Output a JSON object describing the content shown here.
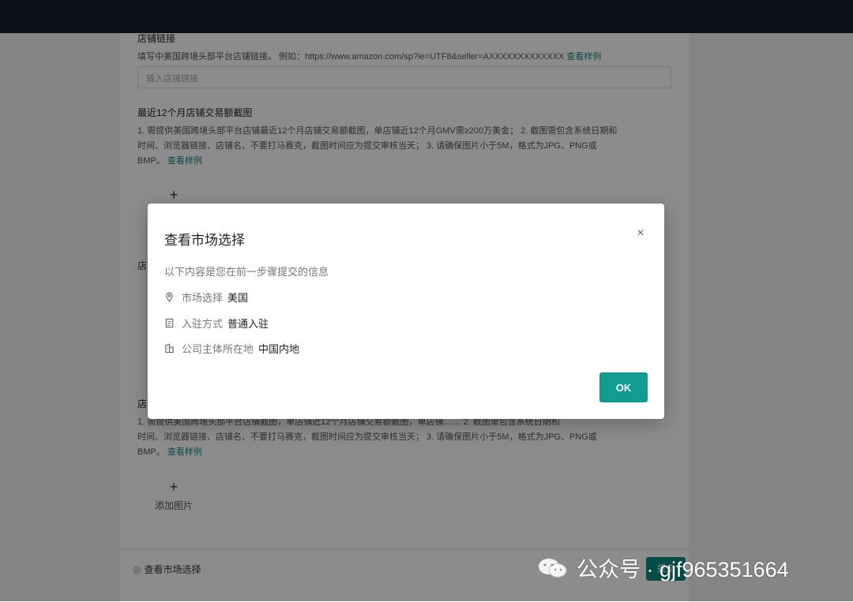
{
  "page": {
    "store_link": {
      "title": "店铺链接",
      "text_prefix": "填写中美国跨境头部平台店铺链接。 例如：https://www.amazon.com/sp?ie=UTF8&seller=AXXXXXXXXXXXXX",
      "example_link": "查看样例",
      "input_placeholder": "输入店铺链接"
    },
    "section_gmv": {
      "title": "最近12个月店铺交易额截图",
      "text_line1": "1. 需提供美国跨境头部平台店铺最近12个月店铺交易额截图，单店铺近12个月GMV需≥200万美金； 2. 截图需包含系统日期和",
      "text_line2": "时间、浏览器链接、店铺名、不要打马赛克，截图时间应为提交审核当天； 3. 请确保图片小于5M，格式为JPG、PNG或",
      "text_line3_prefix": "BMP。",
      "example_link": "查看样例"
    },
    "section_hidden_title": "店",
    "section_third": {
      "title": "店",
      "text_line1": "1. 需提供美国跨境头部平台店铺截图，单店铺近12个月店铺交易额截图，单店铺…… 2. 截图需包含系统日期和",
      "text_line2": "时间、浏览器链接、店铺名、不要打马赛克，截图时间应为提交审核当天； 3. 请确保图片小于5M，格式为JPG、PNG或",
      "text_line3_prefix": "BMP。",
      "example_link": "查看样例",
      "upload_label": "添加图片"
    },
    "footer": {
      "link": "查看市场选择",
      "button": "提交"
    }
  },
  "modal": {
    "title": "查看市场选择",
    "close_symbol": "×",
    "description": "以下内容是您在前一步骤提交的信息",
    "rows": [
      {
        "icon": "location-pin-icon",
        "label": "市场选择",
        "value": "美国"
      },
      {
        "icon": "document-icon",
        "label": "入驻方式",
        "value": "普通入驻"
      },
      {
        "icon": "building-icon",
        "label": "公司主体所在地",
        "value": "中国内地"
      }
    ],
    "ok_label": "OK"
  },
  "watermark": {
    "text": "公众号 · gjf965351664"
  },
  "colors": {
    "accent": "#119b93",
    "topbar": "#1b1f2a",
    "overlay": "rgba(0,0,0,0.45)"
  }
}
